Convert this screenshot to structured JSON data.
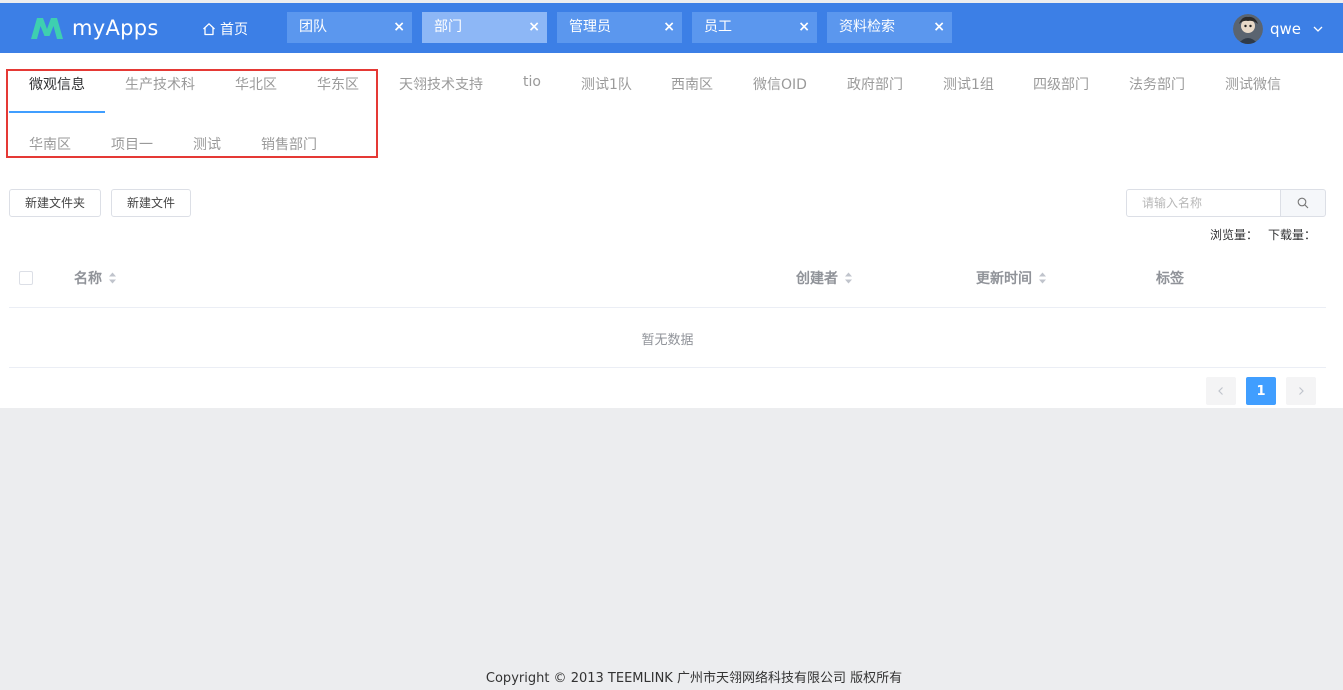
{
  "brand": {
    "name": "myApps",
    "accent": "#3c7fe6"
  },
  "header": {
    "home_label": "首页",
    "tabs": [
      {
        "label": "团队",
        "active": false
      },
      {
        "label": "部门",
        "active": true
      },
      {
        "label": "管理员",
        "active": false
      },
      {
        "label": "员工",
        "active": false
      },
      {
        "label": "资料检索",
        "active": false
      }
    ],
    "close_glyph": "×",
    "user_name": "qwe"
  },
  "department_tabs": [
    "微观信息",
    "生产技术科",
    "华北区",
    "华东区",
    "天翎技术支持",
    "tio",
    "测试1队",
    "西南区",
    "微信OID",
    "政府部门",
    "测试1组",
    "四级部门",
    "法务部门",
    "测试微信",
    "华南区",
    "项目一",
    "测试",
    "销售部门"
  ],
  "toolbar": {
    "new_folder_label": "新建文件夹",
    "new_file_label": "新建文件",
    "search_placeholder": "请输入名称",
    "views_label": "浏览量：",
    "downloads_label": "下载量："
  },
  "table": {
    "columns": {
      "name": "名称",
      "creator": "创建者",
      "updated": "更新时间",
      "tags": "标签"
    },
    "empty_text": "暂无数据"
  },
  "pagination": {
    "current": "1"
  },
  "footer": {
    "copyright": "Copyright © 2013 TEEMLINK 广州市天翎网络科技有限公司 版权所有"
  },
  "icons": [
    "home-icon",
    "close-icon",
    "chevron-down-icon",
    "search-icon",
    "sort-icon",
    "chevron-left-icon",
    "chevron-right-icon"
  ]
}
